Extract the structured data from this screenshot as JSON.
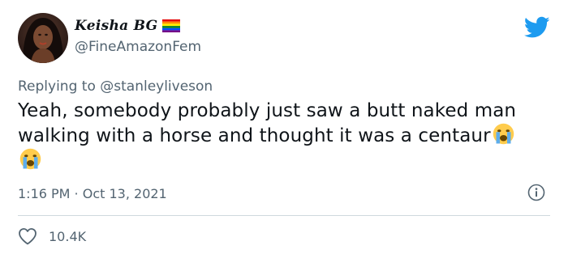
{
  "author": {
    "display_name": "Keisha BG",
    "handle": "@FineAmazonFem",
    "avatar_icon": "profile-photo"
  },
  "reply": {
    "prefix": "Replying to ",
    "mention": "@stanleyliveson"
  },
  "tweet": {
    "text": "Yeah, somebody probably just saw a butt naked man walking with a horse and thought it was a centaur",
    "emojis": [
      "loudly-crying-face",
      "loudly-crying-face"
    ]
  },
  "meta": {
    "timestamp": "1:16 PM · Oct 13, 2021"
  },
  "engagement": {
    "likes": "10.4K"
  },
  "colors": {
    "twitter_blue": "#1d9bf0",
    "secondary_text": "#536471",
    "divider": "#cfd9de"
  },
  "icons": [
    "twitter-bird-icon",
    "info-icon",
    "heart-icon",
    "rainbow-flag-icon"
  ]
}
